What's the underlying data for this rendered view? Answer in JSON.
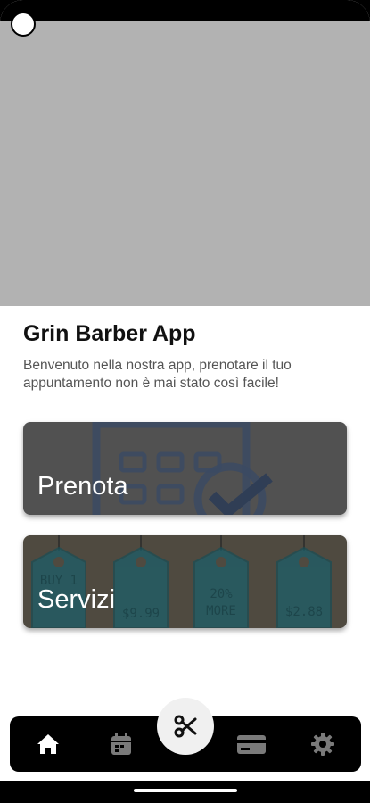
{
  "app": {
    "title": "Grin Barber App",
    "subtitle": "Benvenuto nella nostra app, prenotare il tuo appuntamento non è mai stato così facile!"
  },
  "cards": {
    "prenota": {
      "label": "Prenota",
      "icon": "calendar-check-icon"
    },
    "servizi": {
      "label": "Servizi",
      "tag_texts": [
        "BUY 1",
        "$9.99",
        "20%",
        "MORE",
        "$2.88"
      ]
    }
  },
  "nav": {
    "items": [
      "home-icon",
      "calendar-icon",
      "scissors-icon",
      "credit-card-icon",
      "gear-icon"
    ],
    "active": "home-icon"
  },
  "colors": {
    "hero_placeholder": "#b2b2b2",
    "nav_background": "#000000",
    "tag_teal": "#0b6577"
  }
}
